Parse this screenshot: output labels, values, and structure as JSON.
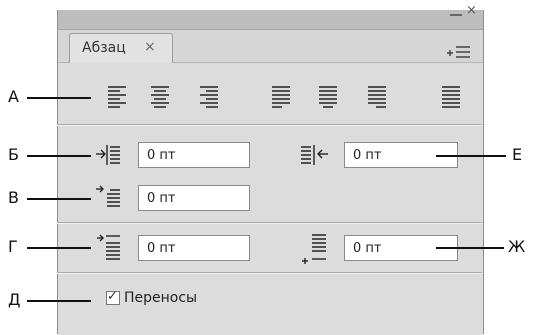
{
  "panel": {
    "tab_label": "Абзац",
    "tab_close": "×",
    "window_close": "×"
  },
  "callouts": {
    "a": "А",
    "b": "Б",
    "v": "В",
    "g": "Г",
    "d": "Д",
    "e": "Е",
    "zh": "Ж"
  },
  "alignment_buttons": [
    {
      "icon": "align-left-icon"
    },
    {
      "icon": "align-center-icon"
    },
    {
      "icon": "align-right-icon"
    },
    {
      "icon": "justify-last-left-icon"
    },
    {
      "icon": "justify-last-center-icon"
    },
    {
      "icon": "justify-last-right-icon"
    },
    {
      "icon": "justify-all-icon"
    }
  ],
  "fields": {
    "left_indent": "0 пт",
    "right_indent": "0 пт",
    "first_line_indent": "0 пт",
    "space_before": "0 пт",
    "space_after": "0 пт"
  },
  "hyphenate": {
    "label": "Переносы",
    "checked": true,
    "check_glyph": "✓"
  }
}
